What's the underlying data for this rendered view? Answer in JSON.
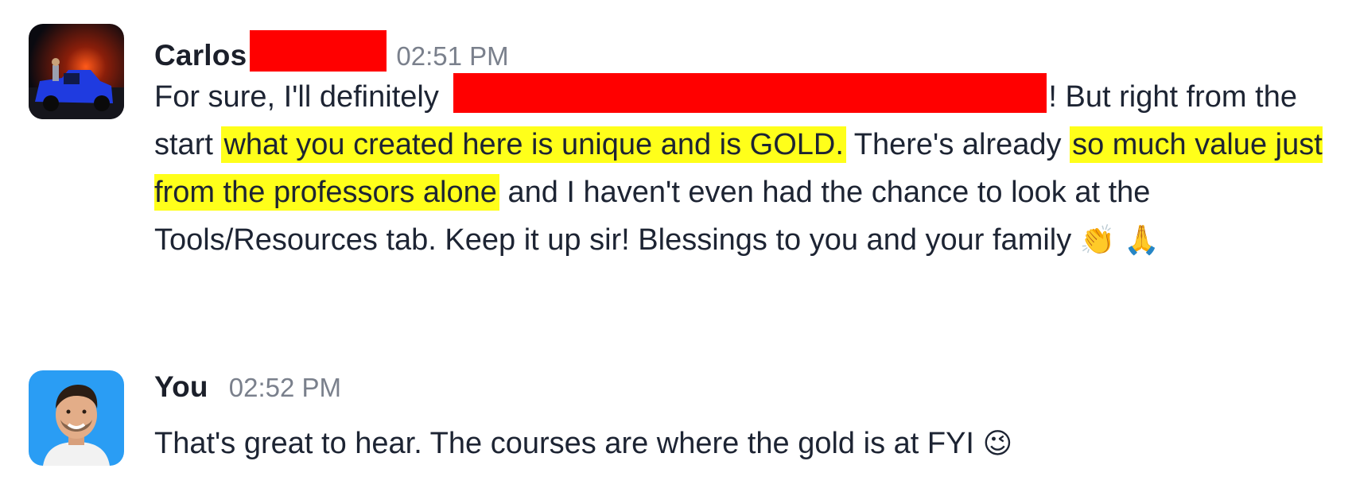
{
  "messages": [
    {
      "sender": "Carlos",
      "time": "02:51 PM",
      "text": {
        "part1": "For sure, I'll definitely ",
        "part2": "! But right from the start ",
        "highlight1": "what you created here is unique and is GOLD.",
        "part3": " There's already ",
        "highlight2": "so much value just from the professors alone",
        "part4": " and I haven't even had the chance to look at the Tools/Resources tab. Keep it up sir! Blessings to you and your family ",
        "emoji1": "👏",
        "emoji2": "🙏"
      }
    },
    {
      "sender": "You",
      "time": "02:52 PM",
      "text": {
        "part1": "That's great to hear. The courses are where the gold is at FYI ",
        "emoji1": "😉"
      }
    }
  ],
  "colors": {
    "redaction": "#ff0000",
    "highlight": "#ffff1a",
    "timestamp": "#7a808c"
  }
}
